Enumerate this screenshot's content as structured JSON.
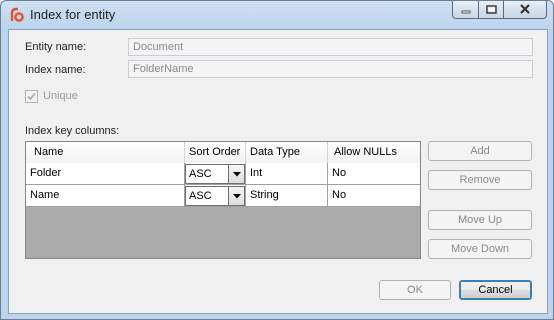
{
  "window": {
    "title": "Index for entity",
    "icon": "app-logo-icon",
    "caption_buttons": [
      "minimize-icon",
      "maximize-icon",
      "close-icon"
    ]
  },
  "form": {
    "entity_name_label": "Entity name:",
    "entity_name_value": "Document",
    "index_name_label": "Index name:",
    "index_name_value": "FolderName",
    "unique_label": "Unique",
    "unique_checked": true,
    "key_columns_label": "Index key columns:"
  },
  "grid": {
    "headers": [
      "Name",
      "Sort Order",
      "Data Type",
      "Allow NULLs"
    ],
    "rows": [
      {
        "name": "Folder",
        "sort_order": "ASC",
        "data_type": "Int",
        "allow_nulls": "No"
      },
      {
        "name": "Name",
        "sort_order": "ASC",
        "data_type": "String",
        "allow_nulls": "No"
      }
    ]
  },
  "side_buttons": {
    "add": "Add",
    "remove": "Remove",
    "move_up": "Move Up",
    "move_down": "Move Down"
  },
  "footer": {
    "ok": "OK",
    "cancel": "Cancel"
  },
  "colors": {
    "title_bar": "#bcd4ee",
    "client_bg": "#f0f0f0",
    "grid_empty_bg": "#ababab",
    "logo_accent": "#e8502a"
  }
}
